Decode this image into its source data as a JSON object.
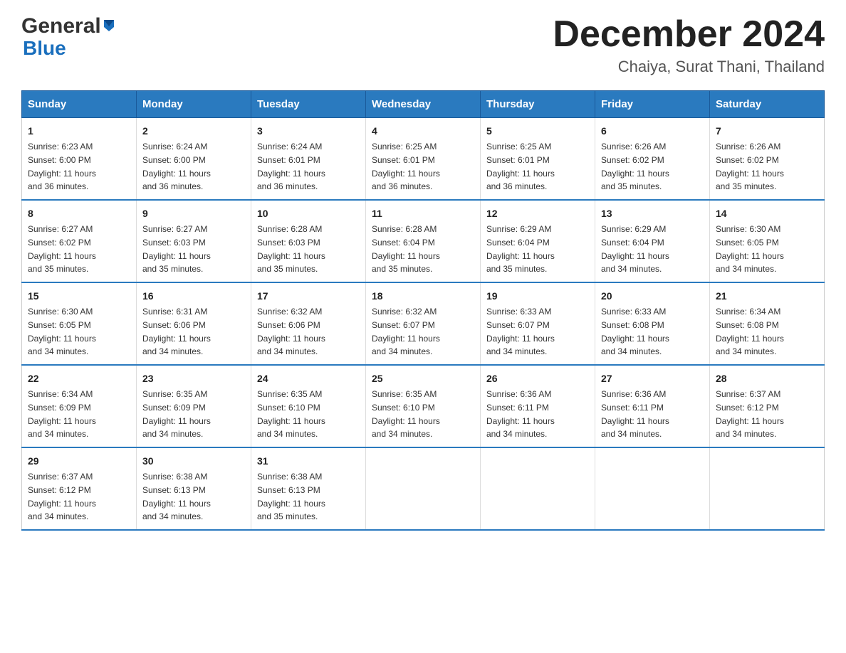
{
  "logo": {
    "general": "General",
    "blue": "Blue"
  },
  "header": {
    "month": "December 2024",
    "location": "Chaiya, Surat Thani, Thailand"
  },
  "days_of_week": [
    "Sunday",
    "Monday",
    "Tuesday",
    "Wednesday",
    "Thursday",
    "Friday",
    "Saturday"
  ],
  "weeks": [
    [
      {
        "day": "1",
        "sunrise": "6:23 AM",
        "sunset": "6:00 PM",
        "daylight": "11 hours and 36 minutes."
      },
      {
        "day": "2",
        "sunrise": "6:24 AM",
        "sunset": "6:00 PM",
        "daylight": "11 hours and 36 minutes."
      },
      {
        "day": "3",
        "sunrise": "6:24 AM",
        "sunset": "6:01 PM",
        "daylight": "11 hours and 36 minutes."
      },
      {
        "day": "4",
        "sunrise": "6:25 AM",
        "sunset": "6:01 PM",
        "daylight": "11 hours and 36 minutes."
      },
      {
        "day": "5",
        "sunrise": "6:25 AM",
        "sunset": "6:01 PM",
        "daylight": "11 hours and 36 minutes."
      },
      {
        "day": "6",
        "sunrise": "6:26 AM",
        "sunset": "6:02 PM",
        "daylight": "11 hours and 35 minutes."
      },
      {
        "day": "7",
        "sunrise": "6:26 AM",
        "sunset": "6:02 PM",
        "daylight": "11 hours and 35 minutes."
      }
    ],
    [
      {
        "day": "8",
        "sunrise": "6:27 AM",
        "sunset": "6:02 PM",
        "daylight": "11 hours and 35 minutes."
      },
      {
        "day": "9",
        "sunrise": "6:27 AM",
        "sunset": "6:03 PM",
        "daylight": "11 hours and 35 minutes."
      },
      {
        "day": "10",
        "sunrise": "6:28 AM",
        "sunset": "6:03 PM",
        "daylight": "11 hours and 35 minutes."
      },
      {
        "day": "11",
        "sunrise": "6:28 AM",
        "sunset": "6:04 PM",
        "daylight": "11 hours and 35 minutes."
      },
      {
        "day": "12",
        "sunrise": "6:29 AM",
        "sunset": "6:04 PM",
        "daylight": "11 hours and 35 minutes."
      },
      {
        "day": "13",
        "sunrise": "6:29 AM",
        "sunset": "6:04 PM",
        "daylight": "11 hours and 34 minutes."
      },
      {
        "day": "14",
        "sunrise": "6:30 AM",
        "sunset": "6:05 PM",
        "daylight": "11 hours and 34 minutes."
      }
    ],
    [
      {
        "day": "15",
        "sunrise": "6:30 AM",
        "sunset": "6:05 PM",
        "daylight": "11 hours and 34 minutes."
      },
      {
        "day": "16",
        "sunrise": "6:31 AM",
        "sunset": "6:06 PM",
        "daylight": "11 hours and 34 minutes."
      },
      {
        "day": "17",
        "sunrise": "6:32 AM",
        "sunset": "6:06 PM",
        "daylight": "11 hours and 34 minutes."
      },
      {
        "day": "18",
        "sunrise": "6:32 AM",
        "sunset": "6:07 PM",
        "daylight": "11 hours and 34 minutes."
      },
      {
        "day": "19",
        "sunrise": "6:33 AM",
        "sunset": "6:07 PM",
        "daylight": "11 hours and 34 minutes."
      },
      {
        "day": "20",
        "sunrise": "6:33 AM",
        "sunset": "6:08 PM",
        "daylight": "11 hours and 34 minutes."
      },
      {
        "day": "21",
        "sunrise": "6:34 AM",
        "sunset": "6:08 PM",
        "daylight": "11 hours and 34 minutes."
      }
    ],
    [
      {
        "day": "22",
        "sunrise": "6:34 AM",
        "sunset": "6:09 PM",
        "daylight": "11 hours and 34 minutes."
      },
      {
        "day": "23",
        "sunrise": "6:35 AM",
        "sunset": "6:09 PM",
        "daylight": "11 hours and 34 minutes."
      },
      {
        "day": "24",
        "sunrise": "6:35 AM",
        "sunset": "6:10 PM",
        "daylight": "11 hours and 34 minutes."
      },
      {
        "day": "25",
        "sunrise": "6:35 AM",
        "sunset": "6:10 PM",
        "daylight": "11 hours and 34 minutes."
      },
      {
        "day": "26",
        "sunrise": "6:36 AM",
        "sunset": "6:11 PM",
        "daylight": "11 hours and 34 minutes."
      },
      {
        "day": "27",
        "sunrise": "6:36 AM",
        "sunset": "6:11 PM",
        "daylight": "11 hours and 34 minutes."
      },
      {
        "day": "28",
        "sunrise": "6:37 AM",
        "sunset": "6:12 PM",
        "daylight": "11 hours and 34 minutes."
      }
    ],
    [
      {
        "day": "29",
        "sunrise": "6:37 AM",
        "sunset": "6:12 PM",
        "daylight": "11 hours and 34 minutes."
      },
      {
        "day": "30",
        "sunrise": "6:38 AM",
        "sunset": "6:13 PM",
        "daylight": "11 hours and 34 minutes."
      },
      {
        "day": "31",
        "sunrise": "6:38 AM",
        "sunset": "6:13 PM",
        "daylight": "11 hours and 35 minutes."
      },
      null,
      null,
      null,
      null
    ]
  ],
  "labels": {
    "sunrise": "Sunrise:",
    "sunset": "Sunset:",
    "daylight": "Daylight:"
  }
}
